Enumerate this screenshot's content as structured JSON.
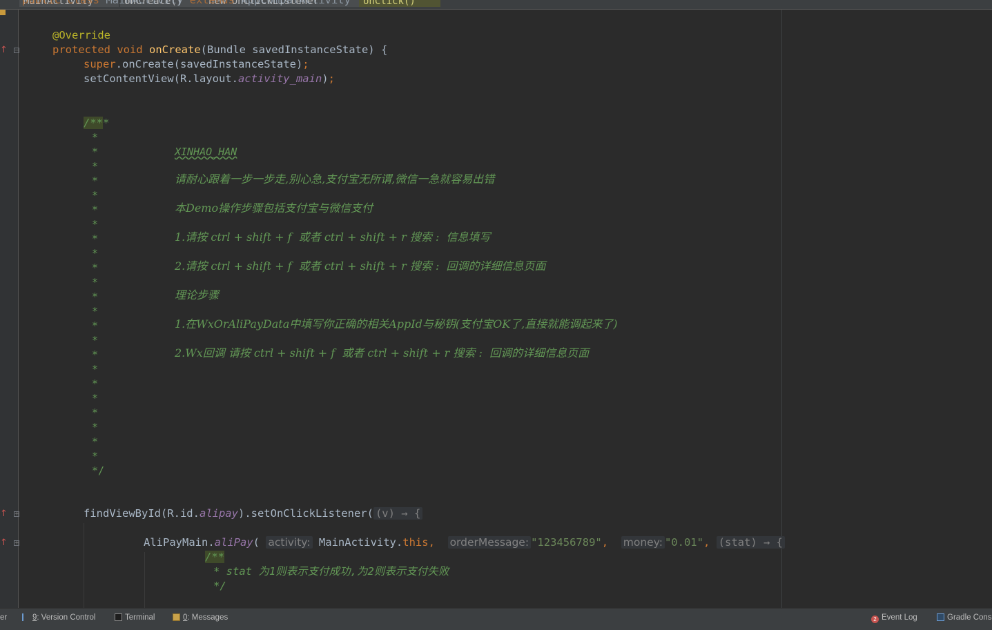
{
  "breadcrumb": {
    "items": [
      {
        "label": "MainActivity",
        "active": false
      },
      {
        "label": "onCreate()",
        "active": false
      },
      {
        "label": "new OnClickListener",
        "active": false
      },
      {
        "label": "onClick()",
        "active": true
      }
    ]
  },
  "code": {
    "l0_kw": "public class",
    "l0_name": " MainActivity",
    "l0_ext": " extends",
    "l0_base": " AppCompatActivity",
    "override": "@Override",
    "protected": "protected",
    "void": " void ",
    "oncreate": "onCreate",
    "oncreate_params": "(Bundle savedInstanceState) {",
    "super": "super",
    "super_call": ".onCreate(savedInstanceState)",
    "semi": ";",
    "setcontent": "setContentView(R.layout.",
    "activity_main": "activity_main",
    "close_paren": ")",
    "doc_open": "/**",
    "doc_star": "*",
    "doc_close": "*/",
    "doc_author": "XINHAO_HAN",
    "doc_line1": "请耐心跟着一步一步走,别心急,支付宝无所谓,微信一急就容易出错",
    "doc_line2": "本Demo操作步骤包括支付宝与微信支付",
    "doc_line3": "1.请按 ctrl + shift + f  或者 ctrl + shift + r 搜索 :  信息填写",
    "doc_line4": "2.请按 ctrl + shift + f  或者 ctrl + shift + r 搜索 :  回调的详细信息页面",
    "doc_line5": "理论步骤",
    "doc_line6": "1.在WxOrAliPayData中填写你正确的相关AppId与秘钥(支付宝OK了,直接就能调起来了)",
    "doc_line7": "2.Wx回调 请按 ctrl + shift + f  或者 ctrl + shift + r 搜索 :  回调的详细信息页面",
    "find_pre": "findViewById(R.id.",
    "alipay_field": "alipay",
    "find_post": ").setOnClickListener(",
    "lambda_v": "(v) → {",
    "alipay_main": "AliPayMain.",
    "alipay_method": "aliPay",
    "open_paren": "(",
    "hint_activity": "activity:",
    "main_activity": " MainActivity.",
    "this_kw": "this",
    "comma": ",",
    "hint_order": "orderMessage:",
    "order_value": "\"123456789\"",
    "hint_money": "money:",
    "money_value": "\"0.01\"",
    "lambda_stat": "(stat) → {",
    "inner_doc_open": "/**",
    "inner_doc_body": "* stat 为1则表示支付成功,为2则表示支付失败",
    "inner_doc_close": "*/"
  },
  "statusbar": {
    "left_cut": "er",
    "version_control_key": "9",
    "version_control": ": Version Control",
    "terminal": "Terminal",
    "messages_key": "0",
    "messages": ": Messages",
    "event_log": "Event Log",
    "gradle_console": "Gradle Cons",
    "event_count": "2"
  },
  "colors": {
    "background": "#2b2b2b",
    "keyword": "#cc7832",
    "comment": "#629755",
    "string": "#6a8759",
    "field": "#9876aa",
    "method": "#ffc66d",
    "annotation": "#bbb529"
  }
}
